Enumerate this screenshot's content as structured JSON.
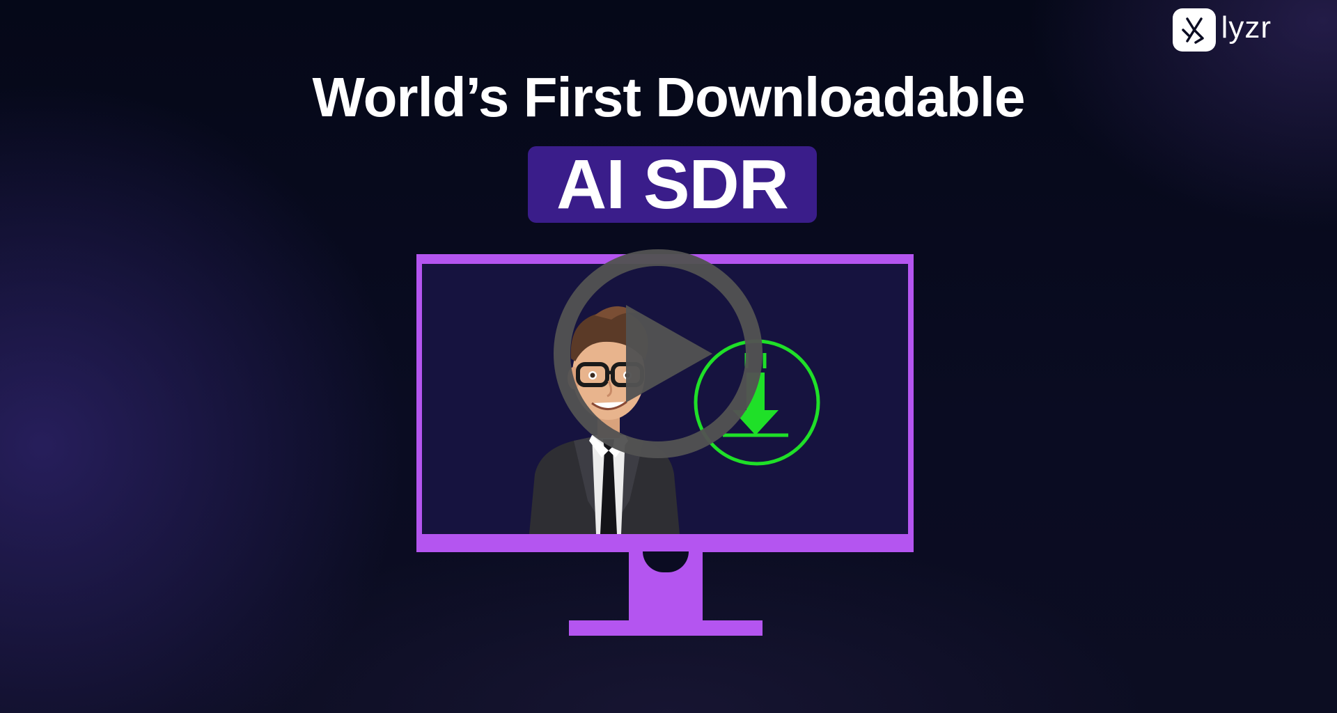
{
  "brand": {
    "name": "lyzr",
    "logo_icon": "lyzr-logo-icon"
  },
  "hero": {
    "headline": "World’s First Downloadable",
    "highlight": "AI SDR"
  },
  "illustration": {
    "screen_icons": [
      "sales-agent-avatar",
      "download-icon"
    ]
  },
  "video": {
    "play_icon": "play-icon"
  },
  "colors": {
    "background": "#070a1d",
    "monitor": "#b455f0",
    "screen": "#16133f",
    "highlight_pill": "#3a1d8a",
    "download_green": "#1fe028",
    "play_overlay": "#555555",
    "text": "#ffffff"
  }
}
